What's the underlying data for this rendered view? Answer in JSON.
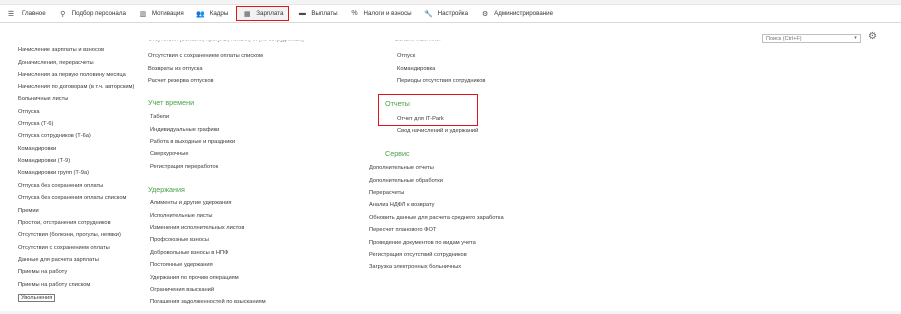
{
  "menu": [
    {
      "icon": "hamburger-icon",
      "glyph": "☰",
      "label": "Главное"
    },
    {
      "icon": "people-search-icon",
      "glyph": "⚲",
      "label": "Подбор персонала"
    },
    {
      "icon": "chart-bars-icon",
      "glyph": "▥",
      "label": "Мотивация"
    },
    {
      "icon": "staff-icon",
      "glyph": "👥",
      "label": "Кадры"
    },
    {
      "icon": "calculator-icon",
      "glyph": "▦",
      "label": "Зарплата"
    },
    {
      "icon": "payout-icon",
      "glyph": "▬",
      "label": "Выплаты"
    },
    {
      "icon": "percent-icon",
      "glyph": "%",
      "label": "Налоги и взносы"
    },
    {
      "icon": "wrench-icon",
      "glyph": "🔧",
      "label": "Настройка"
    },
    {
      "icon": "gear-icon",
      "glyph": "⚙",
      "label": "Администрирование"
    }
  ],
  "search": {
    "placeholder": "Поиск (Ctrl+F)"
  },
  "col1": {
    "items": [
      "Начисление зарплаты и взносов",
      "Доначисления, перерасчеты",
      "Начисления за первую половину месяца",
      "Начисления по договорам (в т.ч. авторским)",
      "Больничные листы",
      "Отпуска",
      "Отпуска (Т-6)",
      "Отпуска сотрудников (Т-6а)",
      "Командировки",
      "Командировки (Т-9)",
      "Командировки групп (Т-9а)",
      "Отпуска без сохранения оплаты",
      "Отпуска без сохранения оплаты списком",
      "Премии",
      "Простои, отстранения сотрудников",
      "Отсутствия (болезни, прогулы, неявки)",
      "Отсутствия с сохранением оплаты",
      "Данные для расчета зарплаты",
      "Приемы на работу",
      "Приемы на работу списком",
      "Увольнения"
    ]
  },
  "col2": {
    "cut_top": "Отсутствия (болезни, прогулы, неявки) ... (по сотрудникам)",
    "top_items": [
      "Отсутствия с сохранением оплаты списком",
      "Возвраты из отпуска",
      "Расчет резерва отпусков"
    ],
    "time_heading": "Учет времени",
    "time_items": [
      "Табели",
      "Индивидуальные графики",
      "Работа в выходные и праздники",
      "Сверхурочные",
      "Регистрация переработок"
    ],
    "deductions_heading": "Удержания",
    "deductions_items": [
      "Алименты и другие удержания",
      "Исполнительные листы",
      "Изменения исполнительных листов",
      "Профсоюзные взносы",
      "Добровольные взносы в НПФ",
      "Постоянные удержания",
      "Удержания по прочим операциям",
      "Ограничения взысканий",
      "Погашения задолженностей по взысканиям"
    ]
  },
  "col3": {
    "cut_top": "Больничный лист",
    "top_items": [
      "Отпуск",
      "Командировка",
      "Периоды отсутствия сотрудников"
    ],
    "reports_heading": "Отчеты",
    "reports_items": [
      "Отчет для IT-Park",
      "Свод начислений и удержаний"
    ],
    "service_heading": "Сервис",
    "service_items": [
      "Дополнительные отчеты",
      "Дополнительные обработки",
      "Перерасчеты",
      "Анализ НДФЛ к возврату",
      "Обновить данные для расчета среднего заработка",
      "Пересчет планового ФОТ",
      "Проведение документов по видам учета",
      "Регистрация отсутствий сотрудников",
      "Загрузка электронных больничных"
    ]
  },
  "colors": {
    "accent_green": "#4aa14a",
    "highlight_red": "#e0141e"
  }
}
